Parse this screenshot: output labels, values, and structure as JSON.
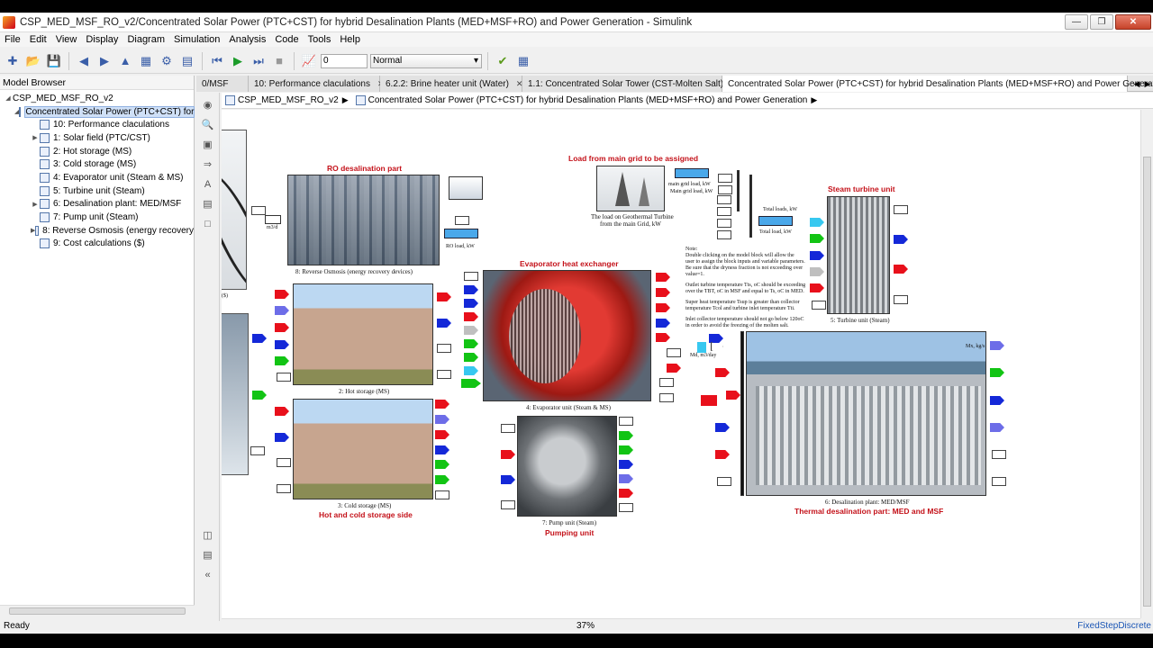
{
  "window": {
    "title": "CSP_MED_MSF_RO_v2/Concentrated Solar Power (PTC+CST) for hybrid Desalination Plants  (MED+MSF+RO) and Power Generation - Simulink"
  },
  "menu": [
    "File",
    "Edit",
    "View",
    "Display",
    "Diagram",
    "Simulation",
    "Analysis",
    "Code",
    "Tools",
    "Help"
  ],
  "toolbar": {
    "stop_time": "0",
    "sim_mode": "Normal"
  },
  "model_browser": {
    "header": "Model Browser",
    "root": "CSP_MED_MSF_RO_v2",
    "selected": "Concentrated Solar Power (PTC+CST) for",
    "items": [
      "10: Performance claculations",
      "1: Solar field (PTC/CST)",
      "2: Hot storage (MS)",
      "3: Cold storage (MS)",
      "4: Evaporator unit (Steam & MS)",
      "5: Turbine unit (Steam)",
      "6: Desalination plant: MED/MSF",
      "7: Pump unit (Steam)",
      "8: Reverse Osmosis (energy recovery",
      "9: Cost calculations ($)"
    ]
  },
  "tabs": [
    "0/MSF",
    "10: Performance claculations",
    "6.2.2: Brine heater  unit (Water)",
    "1.1: Concentrated Solar Tower (CST-Molten Salt)",
    "Concentrated Solar Power (PTC+CST) for hybrid Desalination Plants  (MED+MSF+RO) and Power Generation"
  ],
  "breadcrumb": {
    "root": "CSP_MED_MSF_RO_v2",
    "current": "Concentrated Solar Power (PTC+CST) for hybrid Desalination Plants  (MED+MSF+RO) and Power Generation"
  },
  "diagram": {
    "ro_title": "RO desalination part",
    "ro_caption": "8: Reverse Osmosis (energy recovery devices)",
    "ro_load": "RO load, kW",
    "grid_title": "Load from main grid to be assigned",
    "grid_caption_1": "The load on Geothermal Turbine",
    "grid_caption_2": "from the main Grid, kW",
    "main_grid_load": "main grid load, kW",
    "main_grid_load_2": "Main grid load, kW",
    "total_loads": "Total loads, kW",
    "total_load": "Total load, kW",
    "turbine_title": "Steam turbine unit",
    "turbine_caption": "5: Turbine unit (Steam)",
    "evap_title": "Evaporator heat exchanger",
    "evap_caption": "4: Evaporator unit (Steam & MS)",
    "hot_caption": "2: Hot storage (MS)",
    "cold_caption": "3: Cold storage (MS)",
    "storage_title": "Hot and cold storage side",
    "pump_caption": "7: Pump unit (Steam)",
    "pump_title": "Pumping unit",
    "desal_caption": "6: Desalination plant: MED/MSF",
    "desal_title": "Thermal desalination part: MED and MSF",
    "note": [
      "Note:",
      "Double clicking on the model block will allow the",
      "user to assign the block inputs and variable parameters.",
      "Be sure that the dryness fraction is not exceeding over",
      "value=1.",
      "",
      "Outlet turbine temperature Tts, oC should be exceeding",
      "over the TBT, oC in MSF and equal to Ts, oC in MED.",
      "",
      "Super heat temperature Tsup is greater than collector",
      "temperature Tcol and turbine inlet temperature Tti.",
      "",
      "Inlet collector temperature should not go below 120oC",
      "in order to avoid the freezing of the molten salt."
    ],
    "ms_label": "Mx, kg/s",
    "mfs_label": "Md, m3/day",
    "m3d_label": "m3/d",
    "dollar": "($)"
  },
  "status": {
    "left": "Ready",
    "zoom": "37%",
    "solver": "FixedStepDiscrete"
  }
}
